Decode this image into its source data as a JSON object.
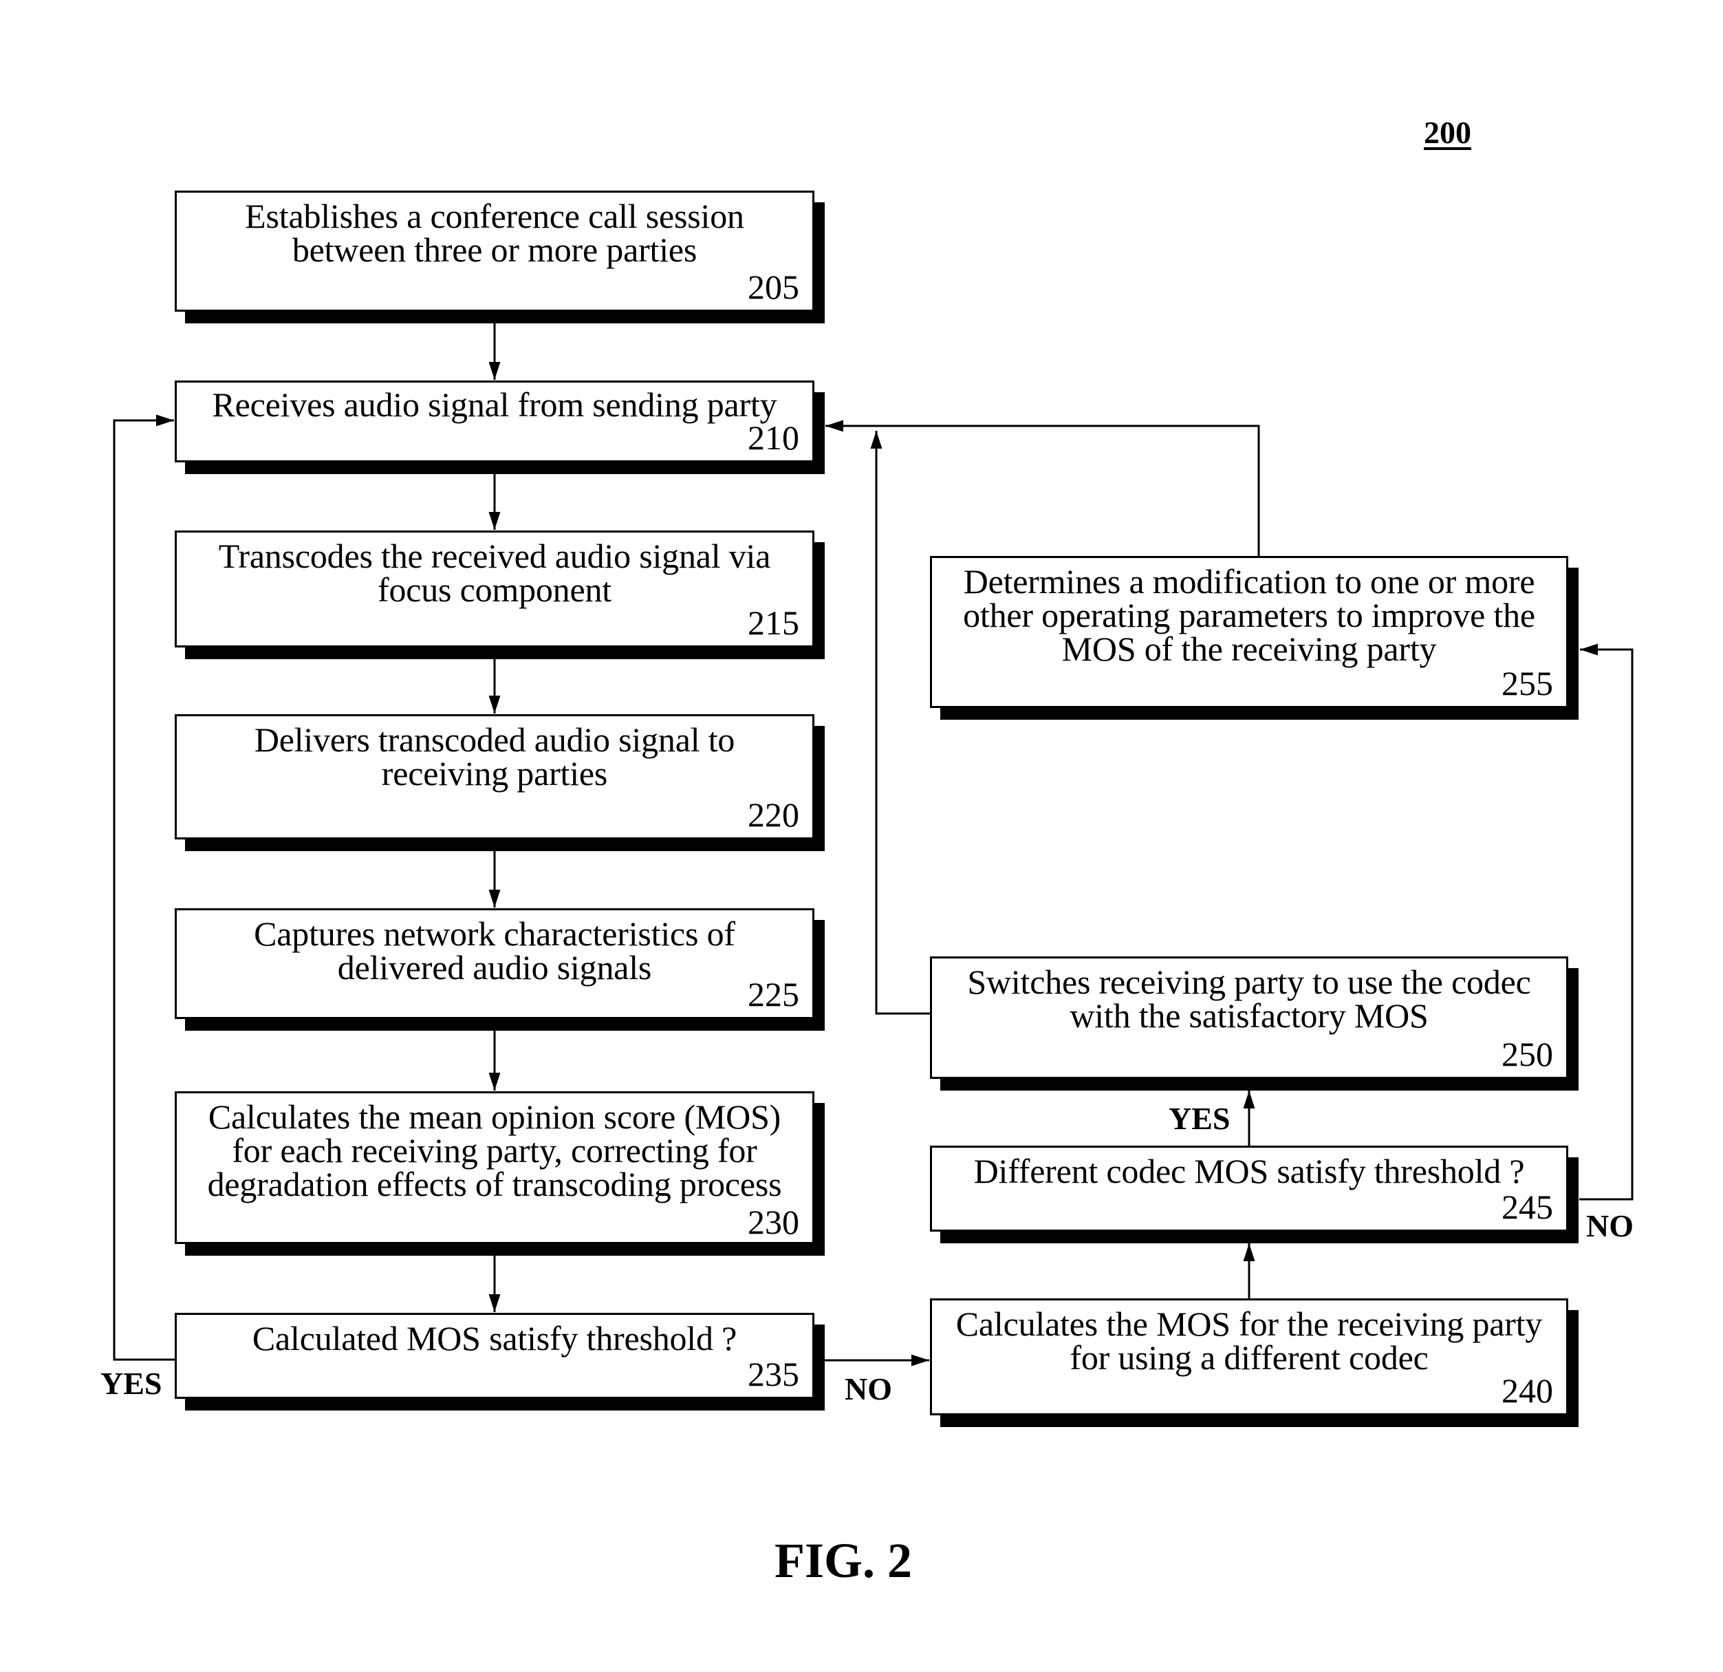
{
  "figure": {
    "reference_number": "200",
    "caption": "FIG. 2"
  },
  "steps": [
    {
      "id": "205",
      "lines": [
        "Establishes a conference call session",
        "between three or more parties"
      ],
      "number": "205"
    },
    {
      "id": "210",
      "lines": [
        "Receives audio signal from sending party"
      ],
      "number": "210"
    },
    {
      "id": "215",
      "lines": [
        "Transcodes the received audio signal via",
        "focus component"
      ],
      "number": "215"
    },
    {
      "id": "220",
      "lines": [
        "Delivers transcoded audio signal to",
        "receiving parties"
      ],
      "number": "220"
    },
    {
      "id": "225",
      "lines": [
        "Captures network characteristics of",
        "delivered audio signals"
      ],
      "number": "225"
    },
    {
      "id": "230",
      "lines": [
        "Calculates the mean opinion score (MOS)",
        "for each receiving party, correcting for",
        "degradation effects of transcoding process"
      ],
      "number": "230"
    },
    {
      "id": "235",
      "lines": [
        "Calculated MOS satisfy threshold ?"
      ],
      "number": "235"
    },
    {
      "id": "240",
      "lines": [
        "Calculates the MOS for the receiving party",
        "for using a different codec"
      ],
      "number": "240"
    },
    {
      "id": "245",
      "lines": [
        "Different codec MOS satisfy threshold ?"
      ],
      "number": "245"
    },
    {
      "id": "250",
      "lines": [
        "Switches receiving party to use the codec",
        "with the satisfactory MOS"
      ],
      "number": "250"
    },
    {
      "id": "255",
      "lines": [
        "Determines a modification to one or more",
        "other operating parameters to improve the",
        "MOS of the receiving party"
      ],
      "number": "255"
    }
  ],
  "edge_labels": {
    "yes_235": "YES",
    "no_235": "NO",
    "yes_245": "YES",
    "no_245": "NO"
  },
  "connections": [
    {
      "from": "205",
      "to": "210"
    },
    {
      "from": "210",
      "to": "215"
    },
    {
      "from": "215",
      "to": "220"
    },
    {
      "from": "220",
      "to": "225"
    },
    {
      "from": "225",
      "to": "230"
    },
    {
      "from": "230",
      "to": "235"
    },
    {
      "from": "235",
      "to": "210",
      "label": "YES"
    },
    {
      "from": "235",
      "to": "240",
      "label": "NO"
    },
    {
      "from": "240",
      "to": "245"
    },
    {
      "from": "245",
      "to": "250",
      "label": "YES"
    },
    {
      "from": "245",
      "to": "255",
      "label": "NO"
    },
    {
      "from": "250",
      "to": "210"
    },
    {
      "from": "255",
      "to": "210"
    }
  ]
}
